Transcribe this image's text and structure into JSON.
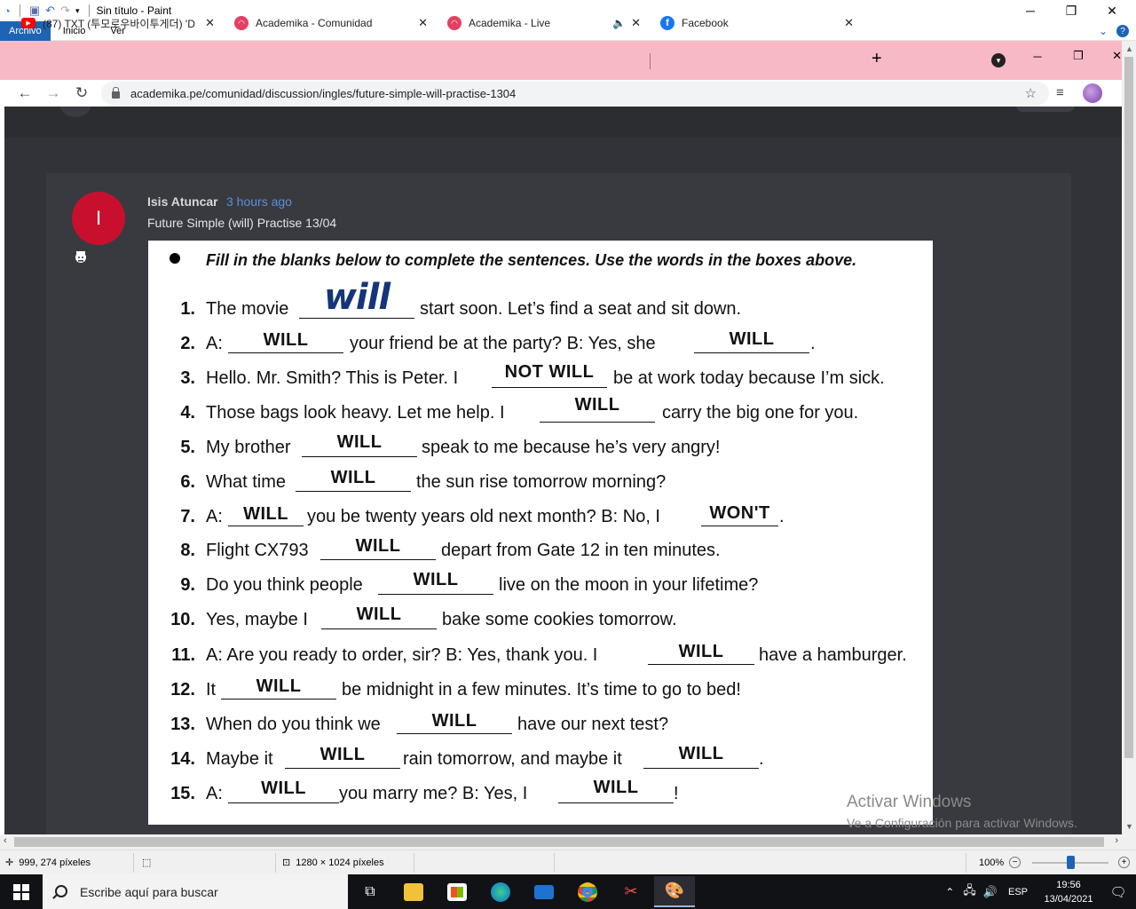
{
  "paint": {
    "title": "Sin título - Paint",
    "tabs": [
      "Archivo",
      "Inicio",
      "Ver"
    ],
    "status": {
      "cursor_pos": "999, 274 píxeles",
      "image_size": "1280 × 1024 píxeles",
      "zoom": "100%"
    }
  },
  "browser": {
    "tabs": [
      {
        "label": "(87) TXT (투모로우바이투게더) 'D",
        "favicon_color": "#ff0000",
        "favicon_glyph": "▶"
      },
      {
        "label": "Academika - Comunidad",
        "favicon_color": "#e4405f",
        "favicon_glyph": "◠"
      },
      {
        "label": "Academika - Live",
        "favicon_color": "#e4405f",
        "favicon_glyph": "◠"
      },
      {
        "label": "Facebook",
        "favicon_color": "#1877f2",
        "favicon_glyph": "f"
      }
    ],
    "url": "academika.pe/comunidad/discussion/ingles/future-simple-will-practise-1304"
  },
  "post": {
    "avatar_letter": "I",
    "author": "Isis Atuncar",
    "time": "3 hours ago",
    "title": "Future Simple (will) Practise 13/04"
  },
  "worksheet": {
    "instruction": "Fill in the blanks below to complete the sentences.  Use the words in the boxes above.",
    "items": [
      {
        "n": "1.",
        "a": "The movie",
        "b": "start soon.  Let’s find a seat and sit down.",
        "ans": "will"
      },
      {
        "n": "2.",
        "a": "A:",
        "b": "your friend be at the party?   B: Yes, she",
        "ans": "WILL",
        "c": ".",
        "ans2": "WILL"
      },
      {
        "n": "3.",
        "a": "Hello. Mr. Smith?  This is Peter.  I",
        "b": "be at work today because I’m sick.",
        "ans": "NOT WILL"
      },
      {
        "n": "4.",
        "a": "Those bags look heavy.  Let me help.  I",
        "b": "carry the big one for you.",
        "ans": "WILL"
      },
      {
        "n": "5.",
        "a": "My brother",
        "b": "speak to me because he’s very angry!",
        "ans": "WILL"
      },
      {
        "n": "6.",
        "a": "What time",
        "b": "the sun rise tomorrow morning?",
        "ans": "WILL"
      },
      {
        "n": "7.",
        "a": "A:",
        "b": "you be twenty years old next month?    B: No, I",
        "ans": "WILL",
        "c": ".",
        "ans2": "WON'T"
      },
      {
        "n": "8.",
        "a": "Flight CX793",
        "b": "depart from Gate 12 in ten minutes.",
        "ans": "WILL"
      },
      {
        "n": "9.",
        "a": "Do you think people",
        "b": "live on the moon in your lifetime?",
        "ans": "WILL"
      },
      {
        "n": "10.",
        "a": "Yes, maybe I",
        "b": "bake some cookies tomorrow.",
        "ans": "WILL"
      },
      {
        "n": "11.",
        "a": "A: Are you ready to order, sir?    B: Yes, thank you.  I",
        "b": "have a hamburger.",
        "ans": "WILL"
      },
      {
        "n": "12.",
        "a": "It",
        "b": "be midnight in a few minutes.  It’s time to go to bed!",
        "ans": "WILL"
      },
      {
        "n": "13.",
        "a": "When do you think we",
        "b": "have our next test?",
        "ans": "WILL"
      },
      {
        "n": "14.",
        "a": "Maybe it",
        "b": "rain tomorrow, and maybe it",
        "ans": "WILL",
        "c": ".",
        "ans2": "WILL"
      },
      {
        "n": "15.",
        "a": "A:",
        "b": "you marry me?    B: Yes, I",
        "ans": "WILL",
        "c": "!",
        "ans2": "WILL"
      }
    ]
  },
  "watermark": {
    "title": "Activar Windows",
    "subtitle": "Ve a Configuración para activar Windows."
  },
  "taskbar": {
    "search_placeholder": "Escribe aquí para buscar",
    "lang": "ESP",
    "time": "19:56",
    "date": "13/04/2021"
  }
}
